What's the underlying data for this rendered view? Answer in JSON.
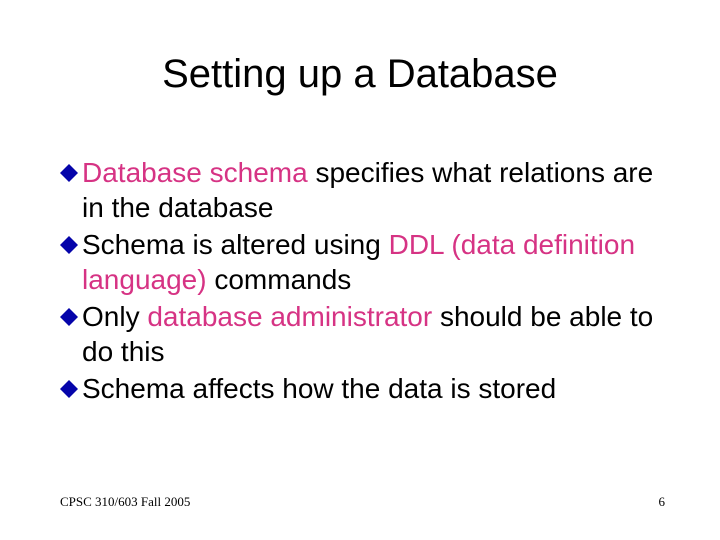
{
  "title": "Setting up a Database",
  "bullets": [
    {
      "pre": "",
      "hl": "Database schema",
      "post": " specifies what relations are in the database"
    },
    {
      "pre": "Schema is altered using ",
      "hl": "DDL (data definition language)",
      "post": " commands"
    },
    {
      "pre": "Only ",
      "hl": "database administrator",
      "post": " should be able to do this"
    },
    {
      "pre": "Schema affects how the data is stored",
      "hl": "",
      "post": ""
    }
  ],
  "footer_left": "CPSC 310/603 Fall 2005",
  "footer_right": "6",
  "colors": {
    "highlight": "#d63384",
    "bullet_fill": "#0504aa"
  }
}
